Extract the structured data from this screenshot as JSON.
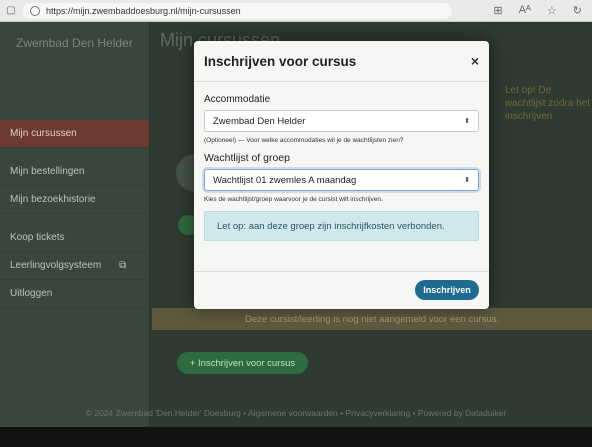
{
  "browser": {
    "url": "https://mijn.zwembaddoesburg.nl/mijn-cursussen"
  },
  "sidebar": {
    "brand": "Zwembad Den Helder",
    "items": [
      {
        "label": "Mijn cursussen",
        "active": true
      },
      {
        "label": "Mijn bestellingen",
        "active": false
      },
      {
        "label": "Mijn bezoekhistorie",
        "active": false
      },
      {
        "label": "Koop tickets",
        "active": false
      },
      {
        "label": "Leerlingvolgsysteem",
        "active": false,
        "icon": "external-link-icon"
      },
      {
        "label": "Uitloggen",
        "active": false
      }
    ]
  },
  "main": {
    "title": "Mijn cursussen",
    "right_notice": "Let op! De wachtlijst zodra het inschrijven",
    "not_registered": "Deze cursist/leerling is nog niet aangemeld voor een cursus.",
    "enroll_button": "+ Inschrijven voor cursus"
  },
  "footer": "© 2024 Zwembad 'Den Helder' Doesburg • Algemene voorwaarden • Privacyverklaring • Powered by Dataduiker",
  "modal": {
    "title": "Inschrijven voor cursus",
    "close": "×",
    "accommodatie_label": "Accommodatie",
    "accommodatie_value": "Zwembad Den Helder",
    "accommodatie_help": "(Optioneel) — Voor welke accommodaties wil je de wachtlijsten zien?",
    "groep_label": "Wachtlijst of groep",
    "groep_value": "Wachtlijst 01 zwemles A maandag",
    "groep_help": "Kies de wachtlijst/groep waarvoor je de cursist wilt inschrijven.",
    "notice": "Let op: aan deze groep zijn inschrijfkosten verbonden.",
    "submit": "Inschrijven"
  },
  "colors": {
    "sidebar_active": "#6b3a31",
    "notice_bg": "#cfe8ec",
    "submit_bg": "#1f6b8f",
    "enroll_green": "#2e6b3f"
  }
}
